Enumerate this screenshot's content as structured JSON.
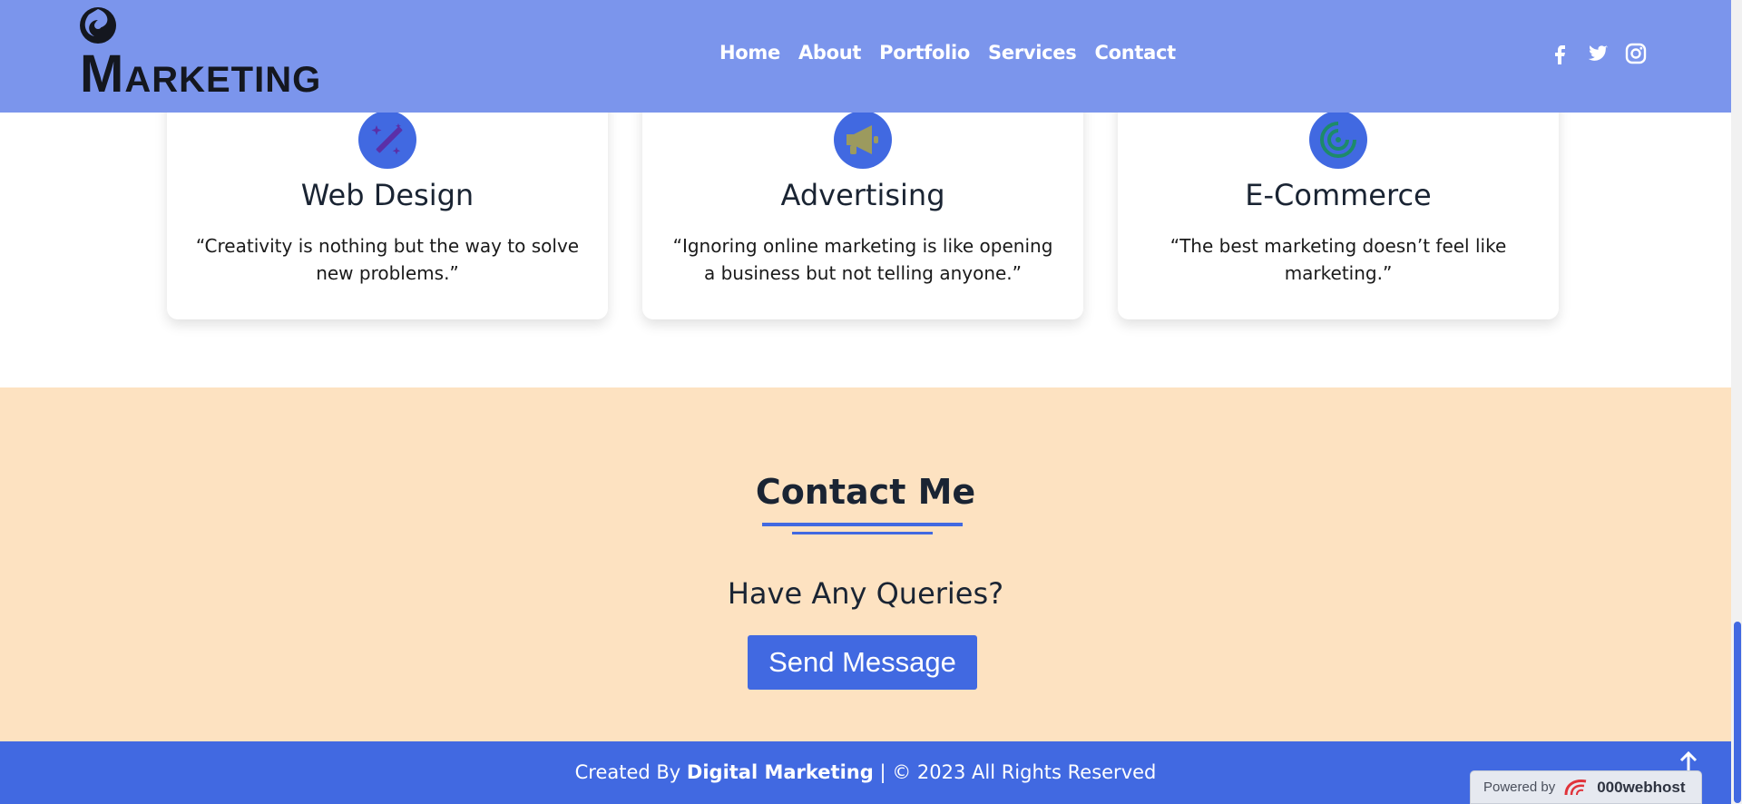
{
  "brand": {
    "logo_cap": "M",
    "logo_rest": "ARKETING"
  },
  "nav": {
    "items": [
      "Home",
      "About",
      "Portfolio",
      "Services",
      "Contact"
    ]
  },
  "social": [
    {
      "icon": "facebook-icon"
    },
    {
      "icon": "twitter-icon"
    },
    {
      "icon": "instagram-icon"
    }
  ],
  "services": [
    {
      "title": "Web Design",
      "quote": "“Creativity is nothing but the way to solve new problems.”",
      "icon": "magic-wand-icon"
    },
    {
      "title": "Advertising",
      "quote": "“Ignoring online marketing is like opening a business but not telling anyone.”",
      "icon": "megaphone-icon"
    },
    {
      "title": "E-Commerce",
      "quote": "“The best marketing doesn’t feel like marketing.”",
      "icon": "target-icon"
    }
  ],
  "contact": {
    "heading": "Contact Me",
    "subheading": "Have Any Queries?",
    "button": "Send Message"
  },
  "footer": {
    "prefix": "Created By ",
    "brand": "Digital Marketing",
    "suffix": " | © 2023 All Rights Reserved"
  },
  "powered": {
    "label": "Powered by",
    "brand": "000webhost"
  },
  "colors": {
    "header": "#7b95ec",
    "accent": "#4169e1",
    "contact_bg": "#fde2c1"
  }
}
